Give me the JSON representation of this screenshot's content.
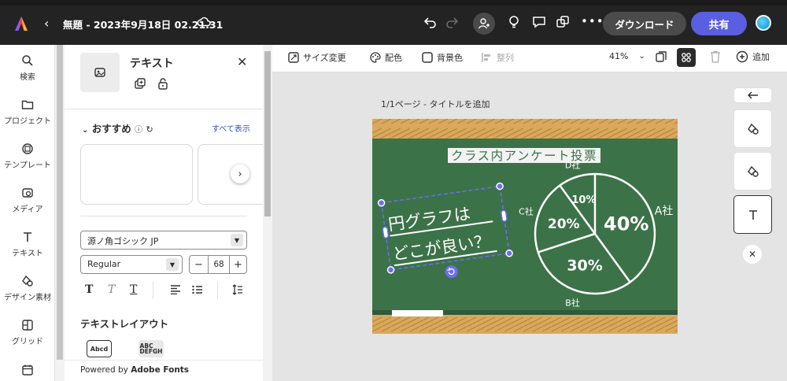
{
  "header": {
    "back_icon": "chevron-left-icon",
    "doc_title": "無題 - 2023年9月18日 02.21.31",
    "download_label": "ダウンロード",
    "share_label": "共有",
    "accent_color": "#5a5ee0"
  },
  "rail": {
    "items": [
      {
        "label": "検索",
        "icon": "search-icon"
      },
      {
        "label": "プロジェクト",
        "icon": "folder-icon"
      },
      {
        "label": "テンプレート",
        "icon": "template-icon"
      },
      {
        "label": "メディア",
        "icon": "media-icon"
      },
      {
        "label": "テキスト",
        "icon": "text-icon"
      },
      {
        "label": "デザイン素材",
        "icon": "shapes-icon"
      },
      {
        "label": "グリッド",
        "icon": "grid-icon"
      },
      {
        "label": "",
        "icon": "calendar-icon"
      }
    ]
  },
  "panel": {
    "title": "テキスト",
    "recommended_label": "おすすめ",
    "see_all_label": "すべて表示",
    "font_family": "源ノ角ゴシック JP",
    "font_weight": "Regular",
    "font_size": "68",
    "minus": "−",
    "plus": "+",
    "text_layout_label": "テキストレイアウト",
    "layout_options": [
      "Abcd",
      "ABC\nDEFGH"
    ],
    "powered_prefix": "Powered by",
    "powered_brand": "Adobe Fonts"
  },
  "toolbar": {
    "resize_label": "サイズ変更",
    "color_label": "配色",
    "background_label": "背景色",
    "align_label": "整列",
    "zoom": "41%",
    "add_label": "追加"
  },
  "canvas": {
    "page_label": "1/1ページ - タイトルを追加"
  },
  "board": {
    "heading": "クラス内アンケート投票",
    "selected_text_line1": "円グラフは",
    "selected_text_line2": "どこが良い？"
  },
  "chart_data": {
    "type": "pie",
    "title": "",
    "categories": [
      "A社",
      "B社",
      "C社",
      "D社"
    ],
    "values": [
      40,
      30,
      20,
      10
    ],
    "labels": [
      "40%",
      "30%",
      "20%",
      "10%"
    ]
  }
}
